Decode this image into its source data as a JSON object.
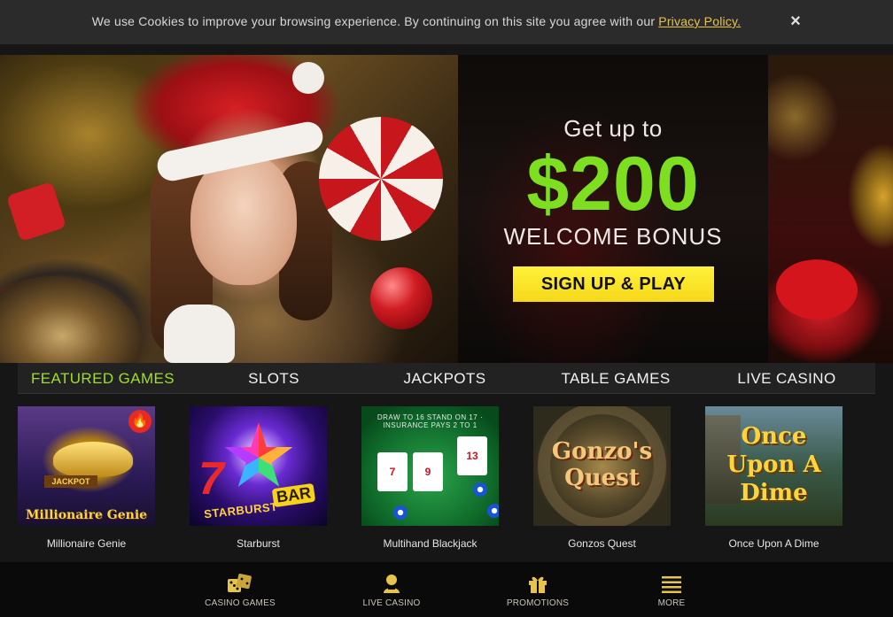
{
  "cookie": {
    "text": "We use Cookies to improve your browsing experience. By continuing on this site you agree with our ",
    "link": "Privacy Policy.",
    "close": "×"
  },
  "promo": {
    "subtitle": "Get up to",
    "amount": "$200",
    "bonus": "WELCOME BONUS",
    "cta": "SIGN UP & PLAY",
    "amount_color": "#7ddf1f",
    "cta_color": "#fff23a"
  },
  "tabs": [
    {
      "label": "FEATURED GAMES",
      "active": true
    },
    {
      "label": "SLOTS",
      "active": false
    },
    {
      "label": "JACKPOTS",
      "active": false
    },
    {
      "label": "TABLE GAMES",
      "active": false
    },
    {
      "label": "LIVE CASINO",
      "active": false
    }
  ],
  "games": [
    {
      "name": "Millionaire Genie",
      "thumb_text": "Millionaire Genie",
      "badge": "JACKPOT",
      "hot_icon": "flame-icon"
    },
    {
      "name": "Starburst",
      "thumb_text": "STARBURST",
      "badge": "BAR",
      "seven": "7"
    },
    {
      "name": "Multihand Blackjack",
      "thumb_text": "DRAW TO 16 STAND ON 17 · INSURANCE PAYS 2 TO 1",
      "cards": [
        "7",
        "9",
        "13"
      ]
    },
    {
      "name": "Gonzos Quest",
      "thumb_text": "Gonzo's Quest"
    },
    {
      "name": "Once Upon A Dime",
      "thumb_text": "Once Upon A Dime"
    }
  ],
  "bottom_nav": [
    {
      "label": "CASINO GAMES",
      "icon": "dice-icon"
    },
    {
      "label": "LIVE CASINO",
      "icon": "dealer-icon"
    },
    {
      "label": "PROMOTIONS",
      "icon": "gift-icon"
    },
    {
      "label": "MORE",
      "icon": "menu-icon"
    }
  ],
  "colors": {
    "accent_green": "#9ddf2a",
    "nav_gold": "#e7c34b"
  }
}
